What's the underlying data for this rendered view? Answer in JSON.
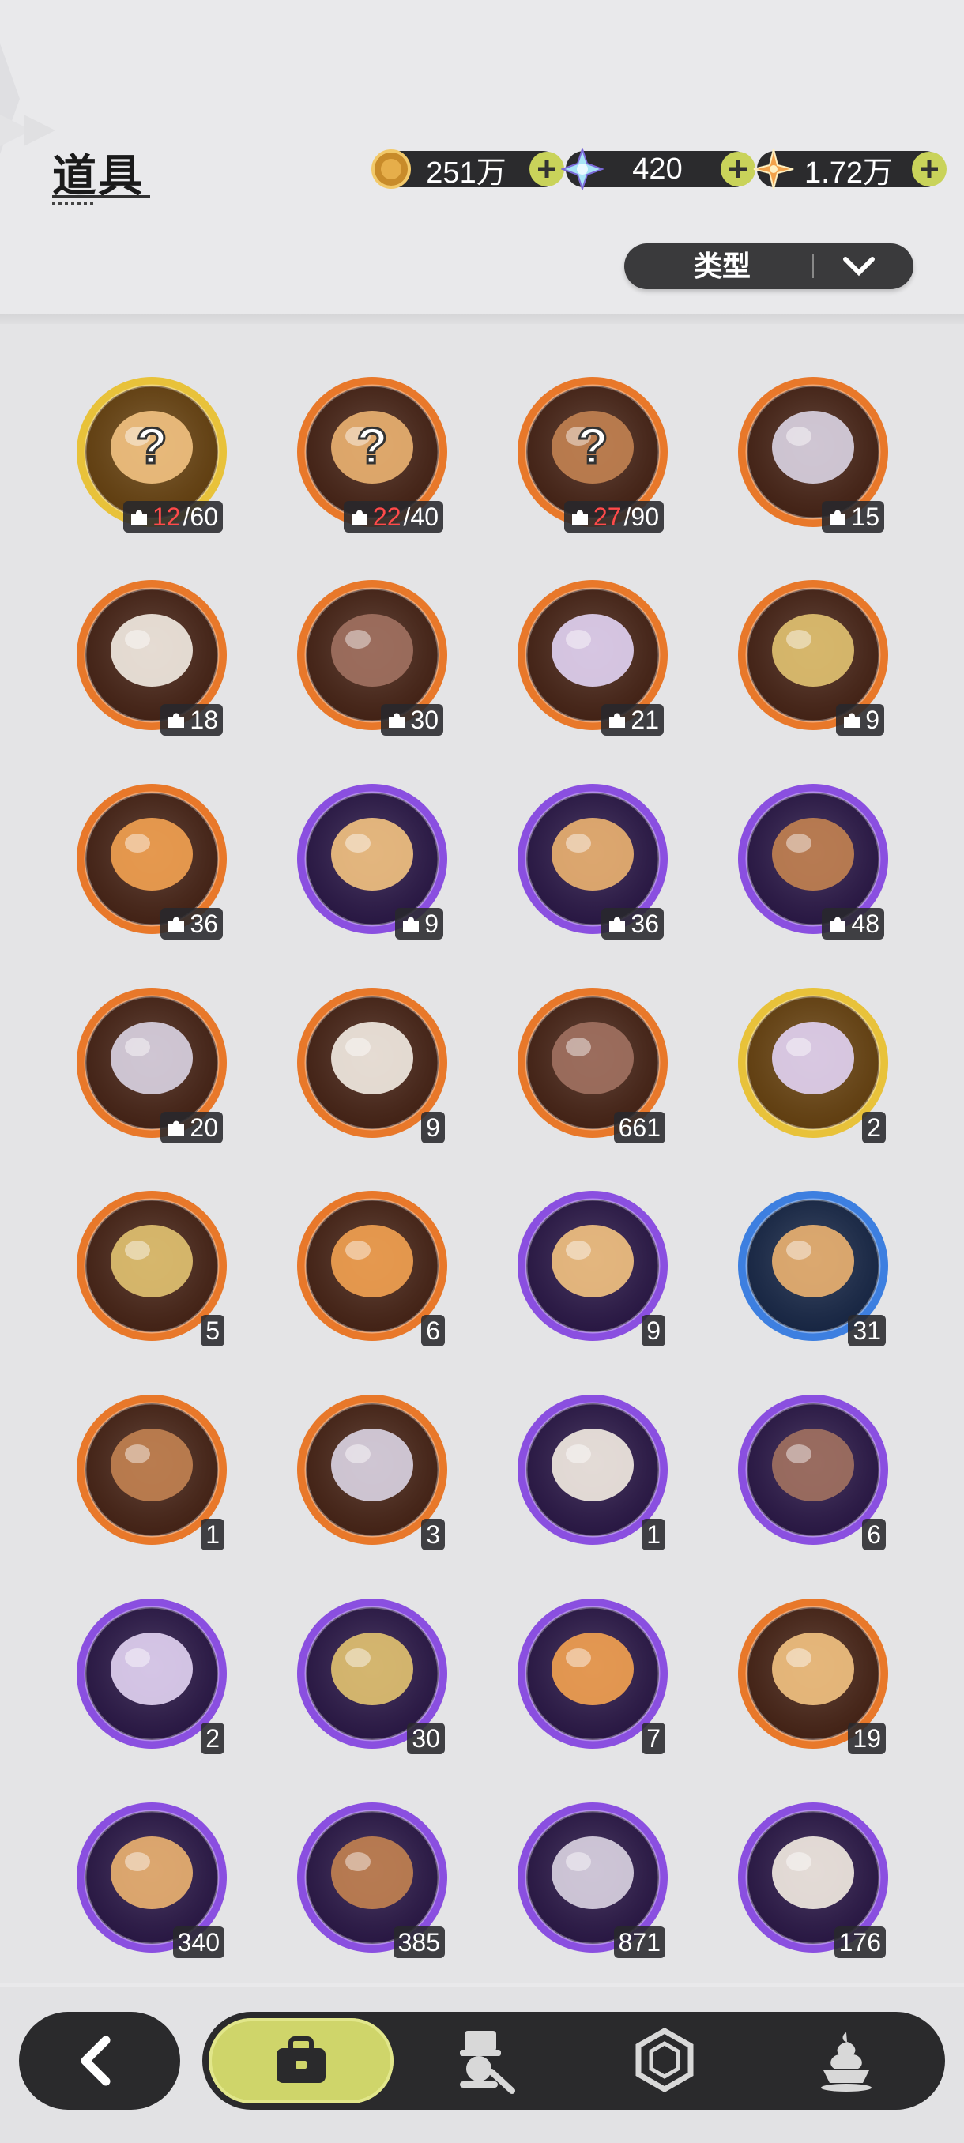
{
  "header": {
    "title": "道具"
  },
  "currencies": [
    {
      "icon": "gold-coin-icon",
      "value": "251万",
      "color": "#d6a64a"
    },
    {
      "icon": "crystal-icon",
      "value": "420",
      "color": "#9fd8f0"
    },
    {
      "icon": "star-shard-icon",
      "value": "1.72万",
      "color": "#f0a04a"
    }
  ],
  "filter": {
    "label": "类型"
  },
  "items": [
    {
      "icon": "mystery-puzzle-gold-icon",
      "rarity": "gold",
      "owned": "12",
      "total": "/60",
      "kind": "fragment-progress"
    },
    {
      "icon": "mystery-puzzle-orange-icon",
      "rarity": "orange",
      "owned": "22",
      "total": "/40",
      "kind": "fragment-progress"
    },
    {
      "icon": "mystery-puzzle-orange-icon",
      "rarity": "orange",
      "owned": "27",
      "total": "/90",
      "kind": "fragment-progress"
    },
    {
      "icon": "bear-fragment-icon",
      "rarity": "orange",
      "count": "15",
      "kind": "fragment"
    },
    {
      "icon": "knight-fragment-icon",
      "rarity": "orange",
      "count": "18",
      "kind": "fragment"
    },
    {
      "icon": "cat-fragment-icon",
      "rarity": "orange",
      "count": "30",
      "kind": "fragment"
    },
    {
      "icon": "white-cat-fragment-icon",
      "rarity": "orange",
      "count": "21",
      "kind": "fragment"
    },
    {
      "icon": "dark-bear-fragment-icon",
      "rarity": "orange",
      "count": "9",
      "kind": "fragment"
    },
    {
      "icon": "purple-cat-fragment-icon",
      "rarity": "orange",
      "count": "36",
      "kind": "fragment"
    },
    {
      "icon": "leaf-cat-fragment-icon",
      "rarity": "purple",
      "count": "9",
      "kind": "fragment"
    },
    {
      "icon": "tanuki-fragment-icon",
      "rarity": "purple",
      "count": "36",
      "kind": "fragment"
    },
    {
      "icon": "yellow-bird-fragment-icon",
      "rarity": "purple",
      "count": "48",
      "kind": "fragment"
    },
    {
      "icon": "tiger-fragment-icon",
      "rarity": "orange",
      "count": "20",
      "kind": "fragment"
    },
    {
      "icon": "pink-crystal-icon",
      "rarity": "orange",
      "count": "9",
      "kind": "item"
    },
    {
      "icon": "blue-crystal-icon",
      "rarity": "orange",
      "count": "661",
      "kind": "item"
    },
    {
      "icon": "gold-card-icon",
      "rarity": "gold",
      "count": "2",
      "kind": "item"
    },
    {
      "icon": "rainbow-card-icon",
      "rarity": "orange",
      "count": "5",
      "kind": "item"
    },
    {
      "icon": "orange-card-icon",
      "rarity": "orange",
      "count": "6",
      "kind": "item"
    },
    {
      "icon": "purple-card-icon",
      "rarity": "purple",
      "count": "9",
      "kind": "item"
    },
    {
      "icon": "blue-card-icon",
      "rarity": "blue",
      "count": "31",
      "kind": "item"
    },
    {
      "icon": "refresh-card-icon",
      "rarity": "orange",
      "count": "1",
      "kind": "item"
    },
    {
      "icon": "clover-ticket-icon",
      "rarity": "orange",
      "count": "3",
      "kind": "item"
    },
    {
      "icon": "gift-box-icon",
      "rarity": "purple",
      "count": "1",
      "kind": "item"
    },
    {
      "icon": "golden-bell-icon",
      "rarity": "purple",
      "count": "6",
      "kind": "item"
    },
    {
      "icon": "magic-mirror-icon",
      "rarity": "purple",
      "count": "2",
      "kind": "item"
    },
    {
      "icon": "scroll-icon",
      "rarity": "purple",
      "count": "30",
      "kind": "item"
    },
    {
      "icon": "peach-icon",
      "rarity": "purple",
      "count": "7",
      "kind": "item"
    },
    {
      "icon": "puzzle-ticket-icon",
      "rarity": "orange",
      "count": "19",
      "kind": "item"
    },
    {
      "icon": "moon-star-coin-icon",
      "rarity": "purple",
      "count": "340",
      "kind": "item"
    },
    {
      "icon": "fist-coin-icon",
      "rarity": "purple",
      "count": "385",
      "kind": "item"
    },
    {
      "icon": "shield-coin-icon",
      "rarity": "purple",
      "count": "871",
      "kind": "item"
    },
    {
      "icon": "heart-coin-icon",
      "rarity": "purple",
      "count": "176",
      "kind": "item"
    }
  ],
  "rarity_colors": {
    "gold": "#e8c23a",
    "orange": "#e8782a",
    "purple": "#8a4fe0",
    "blue": "#3d7fe0"
  },
  "bottom_nav": {
    "back_icon": "back-arrow-icon",
    "tabs": [
      {
        "icon": "bag-icon",
        "active": true
      },
      {
        "icon": "character-icon",
        "active": false
      },
      {
        "icon": "gem-icon",
        "active": false
      },
      {
        "icon": "dessert-icon",
        "active": false
      }
    ]
  }
}
